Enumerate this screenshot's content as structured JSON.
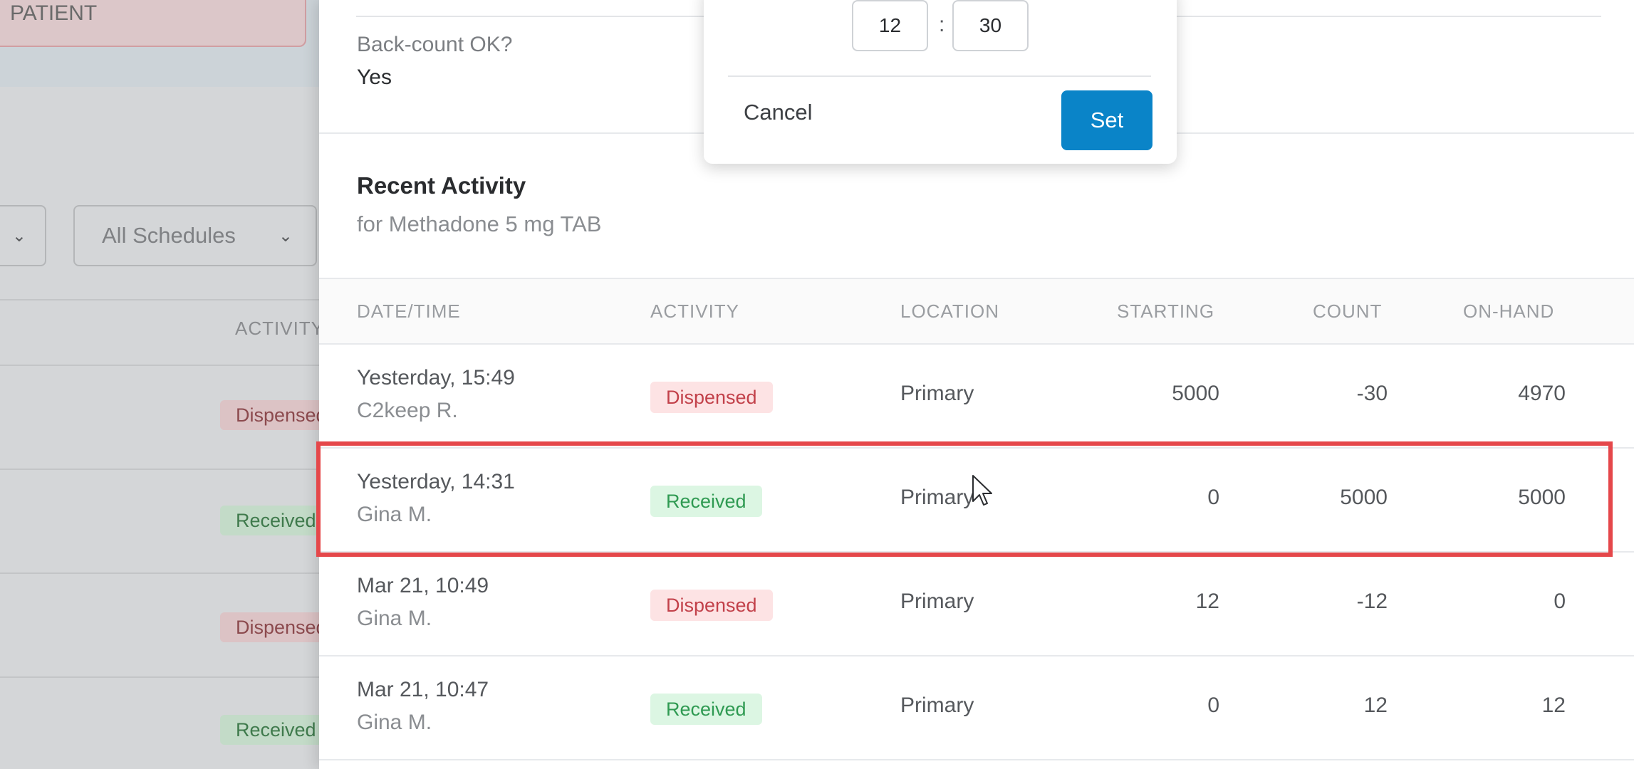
{
  "background": {
    "patient_label": "PATIENT",
    "filter_schedule": "All Schedules",
    "activity_column": "ACTIVITY",
    "row_badges": [
      {
        "label": "Dispensed",
        "type": "dispensed"
      },
      {
        "label": "Received",
        "type": "received"
      },
      {
        "label": "Dispensed",
        "type": "dispensed"
      },
      {
        "label": "Received",
        "type": "received"
      }
    ]
  },
  "panel": {
    "backcount_label": "Back-count OK?",
    "backcount_value": "Yes",
    "section_title": "Recent Activity",
    "section_subtitle": "for Methadone 5 mg TAB"
  },
  "time_picker": {
    "hours": "12",
    "separator": ":",
    "minutes": "30",
    "cancel_label": "Cancel",
    "set_label": "Set"
  },
  "table": {
    "columns": [
      "DATE/TIME",
      "ACTIVITY",
      "LOCATION",
      "STARTING",
      "COUNT",
      "ON-HAND"
    ],
    "rows": [
      {
        "date": "Yesterday, 15:49",
        "user": "C2keep R.",
        "activity": "Dispensed",
        "location": "Primary",
        "starting": "5000",
        "count": "-30",
        "onhand": "4970"
      },
      {
        "date": "Yesterday, 14:31",
        "user": "Gina M.",
        "activity": "Received",
        "location": "Primary",
        "starting": "0",
        "count": "5000",
        "onhand": "5000"
      },
      {
        "date": "Mar 21, 10:49",
        "user": "Gina M.",
        "activity": "Dispensed",
        "location": "Primary",
        "starting": "12",
        "count": "-12",
        "onhand": "0"
      },
      {
        "date": "Mar 21, 10:47",
        "user": "Gina M.",
        "activity": "Received",
        "location": "Primary",
        "starting": "0",
        "count": "12",
        "onhand": "12"
      }
    ]
  },
  "colors": {
    "accent": "#0a84c8",
    "highlight": "#e5474a",
    "dispensed_bg": "#fde3e4",
    "dispensed_text": "#c2414a",
    "received_bg": "#dcf6e3",
    "received_text": "#2f9a52"
  }
}
